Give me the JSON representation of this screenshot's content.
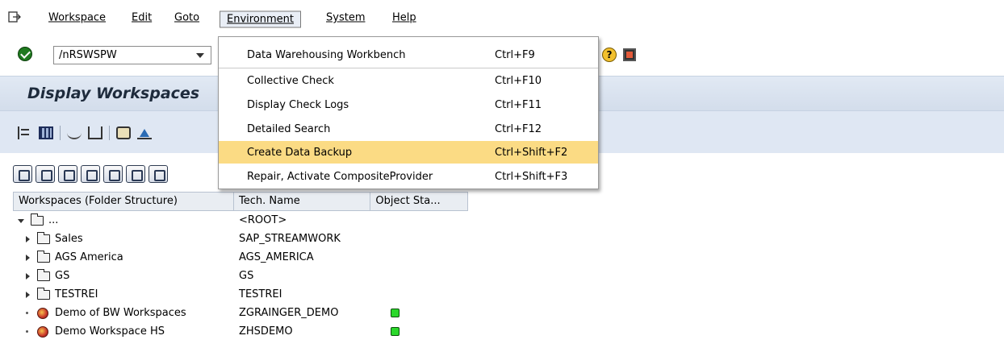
{
  "menubar": {
    "items": [
      "Workspace",
      "Edit",
      "Goto",
      "Environment",
      "System",
      "Help"
    ]
  },
  "command_field": {
    "value": "/nRSWSPW"
  },
  "title": "Display Workspaces",
  "environment_menu": {
    "items": [
      {
        "label": "Data Warehousing Workbench",
        "shortcut": "Ctrl+F9"
      },
      {
        "label": "Collective Check",
        "shortcut": "Ctrl+F10"
      },
      {
        "label": "Display Check Logs",
        "shortcut": "Ctrl+F11"
      },
      {
        "label": "Detailed Search",
        "shortcut": "Ctrl+F12"
      },
      {
        "label": "Create Data Backup",
        "shortcut": "Ctrl+Shift+F2"
      },
      {
        "label": "Repair, Activate CompositeProvider",
        "shortcut": "Ctrl+Shift+F3"
      }
    ],
    "highlighted_index": 4,
    "highlight_color": "#fbdb84"
  },
  "tree": {
    "columns": [
      "Workspaces (Folder Structure)",
      "Tech. Name",
      "Object Sta..."
    ],
    "rows": [
      {
        "label": "...",
        "tech": "<ROOT>"
      },
      {
        "label": "Sales",
        "tech": "SAP_STREAMWORK"
      },
      {
        "label": "AGS America",
        "tech": "AGS_AMERICA"
      },
      {
        "label": "GS",
        "tech": "GS"
      },
      {
        "label": "TESTREI",
        "tech": "TESTREI"
      },
      {
        "label": "Demo of BW Workspaces",
        "tech": "ZGRAINGER_DEMO"
      },
      {
        "label": "Demo Workspace HS",
        "tech": "ZHSDEMO"
      }
    ],
    "status_color": "#2bd82b"
  }
}
